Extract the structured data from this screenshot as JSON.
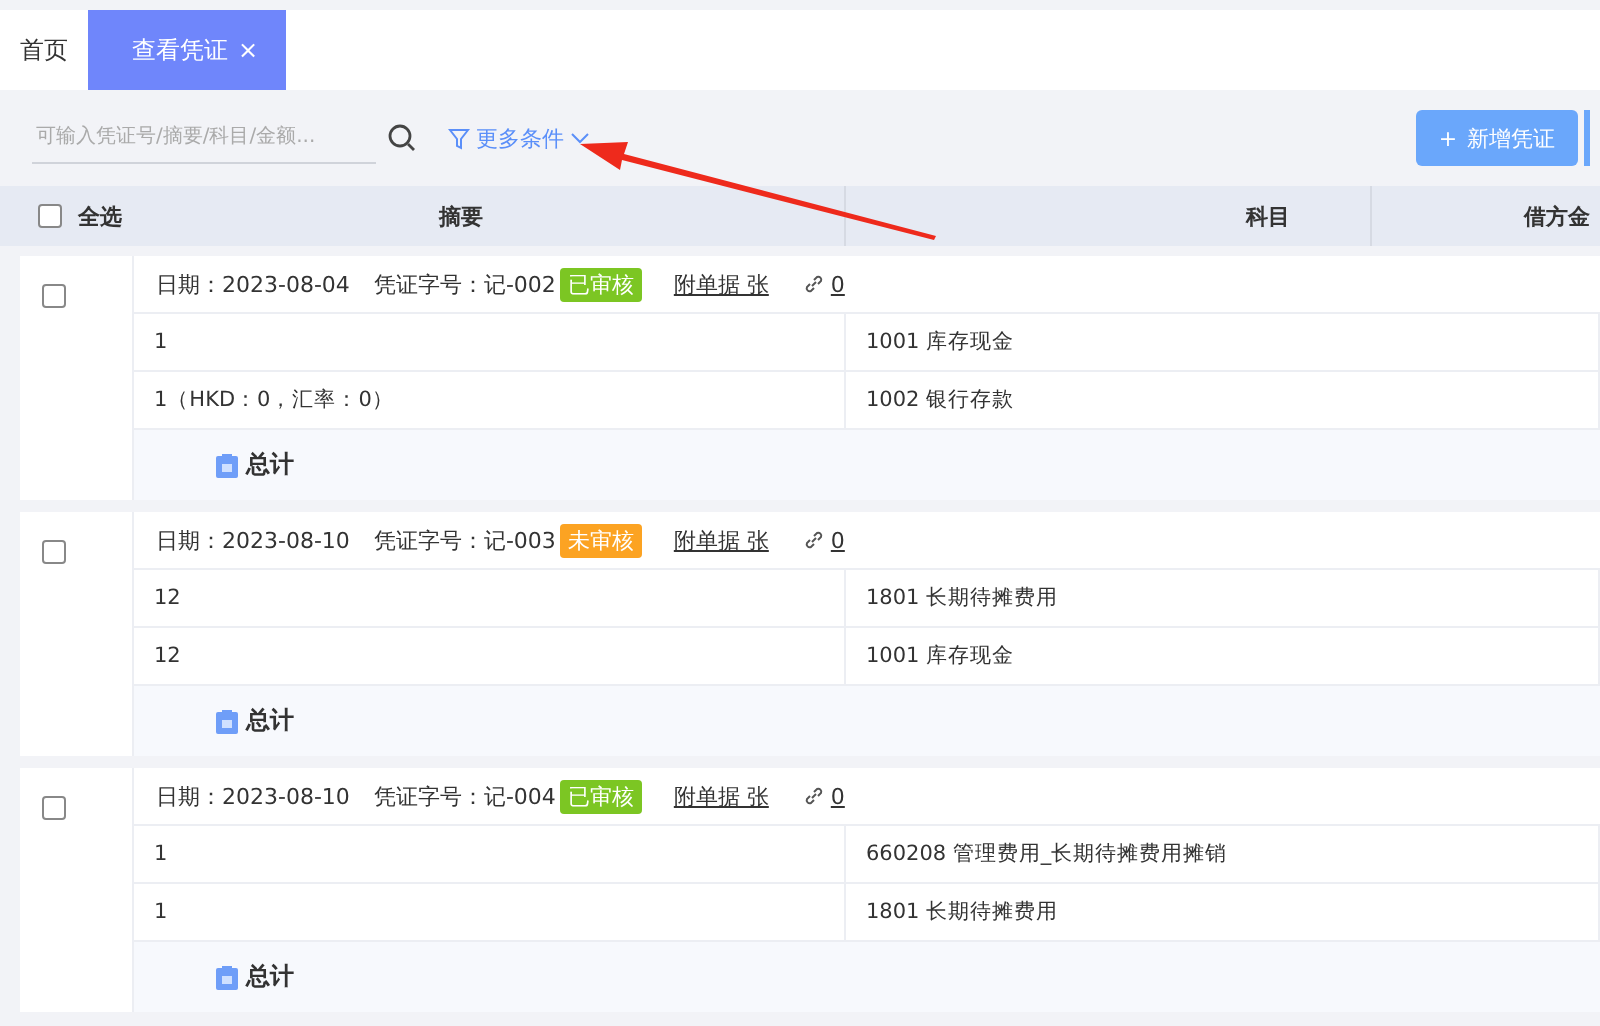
{
  "tabs": [
    {
      "label": "首页",
      "selected": false
    },
    {
      "label": "查看凭证",
      "selected": true,
      "close": "×"
    }
  ],
  "search": {
    "placeholder": "可输入凭证号/摘要/科目/金额..."
  },
  "filter": {
    "label": "更多条件"
  },
  "add_button": {
    "label": "新增凭证",
    "icon": "+"
  },
  "table": {
    "columns": [
      {
        "kind": "select",
        "label": "全选",
        "checked": false
      },
      {
        "kind": "text",
        "label": "摘要"
      },
      {
        "kind": "text",
        "label": "科目"
      },
      {
        "kind": "text",
        "label": "借方金"
      }
    ],
    "vouchers": [
      {
        "checked": false,
        "date": "日期：2023-08-04",
        "number": "凭证字号：记-002",
        "status": "已审核",
        "color": "#7cc623",
        "attachments": "附单据 张",
        "links": "0",
        "rows": [
          {
            "summary": "1",
            "account": "1001 库存现金"
          },
          {
            "summary": "1（HKD：0，汇率：0）",
            "account": "1002 银行存款"
          }
        ],
        "total": "总计"
      },
      {
        "checked": false,
        "date": "日期：2023-08-10",
        "number": "凭证字号：记-003",
        "status": "未审核",
        "color": "#fca322",
        "attachments": "附单据 张",
        "links": "0",
        "rows": [
          {
            "summary": "12",
            "account": "1801 长期待摊费用"
          },
          {
            "summary": "12",
            "account": "1001 库存现金"
          }
        ],
        "total": "总计"
      },
      {
        "checked": false,
        "date": "日期：2023-08-10",
        "number": "凭证字号：记-004",
        "status": "已审核",
        "color": "#7cc623",
        "attachments": "附单据 张",
        "links": "0",
        "rows": [
          {
            "summary": "1",
            "account": "660208 管理费用_长期待摊费用摊销"
          },
          {
            "summary": "1",
            "account": "1801 长期待摊费用"
          }
        ],
        "total": "总计"
      }
    ]
  }
}
